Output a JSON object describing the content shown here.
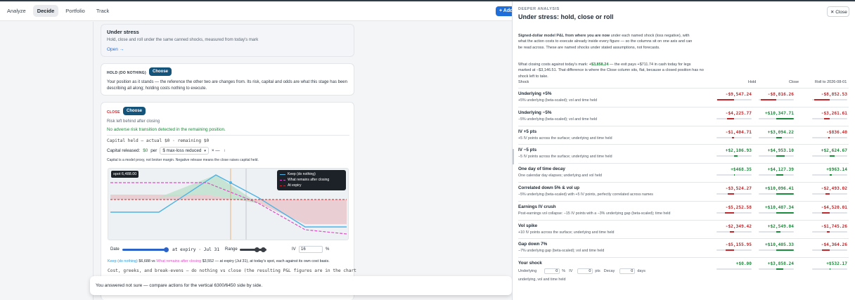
{
  "nav": {
    "tabs": [
      {
        "label": "Analyze"
      },
      {
        "label": "Decide"
      },
      {
        "label": "Portfolio"
      },
      {
        "label": "Track"
      }
    ],
    "add_button": "+ Add"
  },
  "left": {
    "under_stress": {
      "title": "Under stress",
      "description": "Hold, close and roll under the same canned shocks, measured from today's mark",
      "open_link": "Open →"
    },
    "hold": {
      "label": "HOLD (DO NOTHING)",
      "choose": "Choose",
      "description": "Your position as it stands — the reference the other two are changes from. Its risk, capital and odds are what this stage has been describing all along; holding costs nothing to execute."
    },
    "close": {
      "label": "CLOSE",
      "choose": "Choose",
      "risk_left": "Risk left behind after closing",
      "no_adverse": "No adverse risk transition detected in the remaining position.",
      "capital_held": "Capital held — actual $0 · remaining $0",
      "capital_released_label": "Capital released:",
      "capital_released_value": "$0",
      "per": "per",
      "per_select": "$ max-loss reduced",
      "ratio": "× —",
      "info": "i",
      "note": "Capital is a model proxy, not broker margin. Negative release means the close raises capital held.",
      "spot_tag": "spot 6,488.00",
      "legend": [
        {
          "label": "Keep (do nothing)"
        },
        {
          "label": "What remains after closing"
        },
        {
          "label": "At expiry"
        }
      ],
      "controls": {
        "date_label": "Date",
        "date_value": "at expiry · Jul 31",
        "range_label": "Range",
        "iv_label": "IV",
        "iv_value": "16",
        "iv_unit": "%"
      },
      "summary": {
        "keep_label": "Keep (do nothing)",
        "keep_value": "$6,688",
        "vs": "vs",
        "remain_label": "What remains after closing",
        "remain_value": "$3,552",
        "tail": "— at expiry (Jul 31), at today's spot, each against its own cost basis."
      },
      "cost_line": "Cost, greeks, and break-evens — do nothing vs close (the resulting P&L figures are in the chart"
    },
    "toast": "You answered not sure — compare actions for the vertical 6300/6450 side by side."
  },
  "panel": {
    "eyebrow": "DEEPER ANALYSIS",
    "title": "Under stress: hold, close or roll",
    "close_button": "✕ Close",
    "intro_bold": "Signed-dollar model P&L from where you are now",
    "intro_rest": " under each named shock (loss negative), with what the action costs to execute already inside every figure — so the columns sit on one axis and can be read across. These are named shocks under stated assumptions, not forecasts.",
    "mark_pre": "What closing costs against today's mark: ",
    "mark_value": "+$3,858.24",
    "mark_post": " — the exit pays +$711.74 in cash today for legs marked at −$3,146.51. That difference is where the Close column sits, flat, because a closed position has no shock left to take.",
    "columns": {
      "shock": "Shock",
      "hold": "Hold",
      "close": "Close",
      "roll": "Roll to 2026-08-01"
    },
    "rows": [
      {
        "name": "Underlying +5%",
        "desc": "+5% underlying (beta-scaled); vol and time held",
        "hold": "-$9,547.24",
        "close": "-$8,816.26",
        "roll": "-$8,852.53",
        "hs": -0.95,
        "cs": -0.88,
        "rs": -0.88
      },
      {
        "name": "Underlying −5%",
        "desc": "−5% underlying (beta-scaled); vol and time held",
        "hold": "-$4,225.77",
        "close": "+$10,347.71",
        "roll": "-$3,261.61",
        "hs": -0.42,
        "cs": 1.0,
        "rs": -0.33
      },
      {
        "name": "IV +5 pts",
        "desc": "+5 IV points across the surface; underlying and time held",
        "hold": "-$1,404.71",
        "close": "+$3,094.22",
        "roll": "-$836.40",
        "hs": -0.14,
        "cs": 0.3,
        "rs": -0.08
      },
      {
        "name": "IV −5 pts",
        "desc": "−5 IV points across the surface; underlying and time held",
        "hold": "+$2,106.93",
        "close": "+$4,953.10",
        "roll": "+$2,624.67",
        "hs": 0.21,
        "cs": 0.48,
        "rs": 0.26
      },
      {
        "name": "One day of time decay",
        "desc": "One calendar day elapses; underlying and vol held",
        "hold": "+$468.35",
        "close": "+$4,127.39",
        "roll": "+$963.14",
        "hs": 0.05,
        "cs": 0.4,
        "rs": 0.1
      },
      {
        "name": "Correlated down 5% & vol up",
        "desc": "−5% underlying (beta-scaled) with +5 IV points, perfectly correlated across names",
        "hold": "-$3,524.27",
        "close": "+$10,096.41",
        "roll": "-$2,493.02",
        "hs": -0.35,
        "cs": 0.98,
        "rs": -0.25
      },
      {
        "name": "Earnings IV crush",
        "desc": "Post-earnings vol collapse: −15 IV points with a −3% underlying gap (beta-scaled); time held",
        "hold": "-$5,252.58",
        "close": "+$10,407.34",
        "roll": "-$4,520.01",
        "hs": -0.52,
        "cs": 1.0,
        "rs": -0.45
      },
      {
        "name": "Vol spike",
        "desc": "+10 IV points across the surface; underlying and time held",
        "hold": "-$2,349.42",
        "close": "+$2,549.04",
        "roll": "-$1,745.26",
        "hs": -0.23,
        "cs": 0.25,
        "rs": -0.17
      },
      {
        "name": "Gap down 7%",
        "desc": "−7% underlying gap (beta-scaled); vol and time held",
        "hold": "-$5,155.95",
        "close": "+$10,405.33",
        "roll": "-$4,364.26",
        "hs": -0.5,
        "cs": 1.0,
        "rs": -0.43
      }
    ],
    "your_shock": {
      "name": "Your shock",
      "hold": "+$0.00",
      "close": "+$3,858.24",
      "roll": "+$532.17",
      "hs": 0.0,
      "cs": 0.38,
      "rs": 0.05,
      "underlying_label": "Underlying",
      "underlying_value": "0",
      "underlying_unit": "%",
      "iv_label": "IV",
      "iv_value": "0",
      "iv_unit": "pts",
      "decay_label": "Decay",
      "decay_value": "0",
      "decay_unit": "days",
      "desc": "underlying, vol and time held"
    }
  },
  "colors": {
    "keep": "#4fb3e3",
    "remain": "#d94fc5",
    "expiry": "#c0282d",
    "choose": "#14537a",
    "positive": "#1c8a3c",
    "negative": "#c0282d",
    "accent": "#1e6fd9"
  }
}
